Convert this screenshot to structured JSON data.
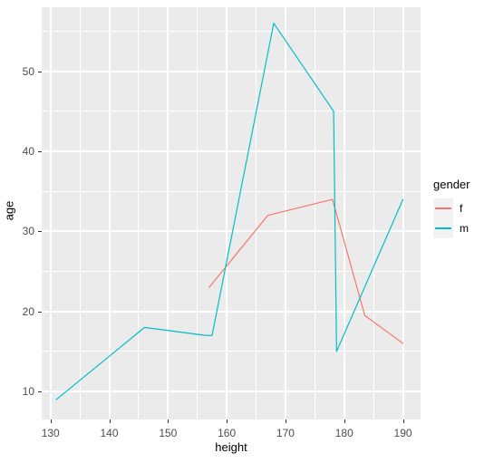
{
  "chart_data": {
    "type": "line",
    "title": "",
    "xlabel": "height",
    "ylabel": "age",
    "xlim": [
      128.5,
      193
    ],
    "ylim": [
      6.5,
      58
    ],
    "x_ticks": [
      130,
      140,
      150,
      160,
      170,
      180,
      190
    ],
    "y_ticks": [
      10,
      20,
      30,
      40,
      50
    ],
    "x_minor_ticks": [
      135,
      145,
      155,
      165,
      175,
      185
    ],
    "y_minor_ticks": [
      15,
      25,
      35,
      45,
      55
    ],
    "grid": true,
    "legend": {
      "title": "gender",
      "position": "right",
      "entries": [
        {
          "label": "f",
          "color": "#F8766D"
        },
        {
          "label": "m",
          "color": "#00BFC4"
        }
      ]
    },
    "series": [
      {
        "name": "f",
        "color": "#F8766D",
        "points": [
          [
            157.0,
            23.0
          ],
          [
            167.0,
            32.0
          ],
          [
            178.0,
            34.0
          ],
          [
            183.5,
            19.5
          ],
          [
            190.0,
            16.0
          ]
        ]
      },
      {
        "name": "m",
        "color": "#00BFC4",
        "points": [
          [
            131.0,
            9.0
          ],
          [
            146.0,
            18.0
          ],
          [
            156.5,
            17.0
          ],
          [
            157.5,
            17.0
          ],
          [
            168.0,
            56.0
          ],
          [
            178.2,
            45.0
          ],
          [
            178.7,
            15.0
          ],
          [
            190.0,
            34.0
          ]
        ]
      }
    ]
  },
  "panel": {
    "background_color": "#EBEBEB",
    "gridline_color": "#FFFFFF"
  },
  "axes": {
    "tick_label_color": "#4D4D4D",
    "tick_mark_color": "#333333"
  }
}
